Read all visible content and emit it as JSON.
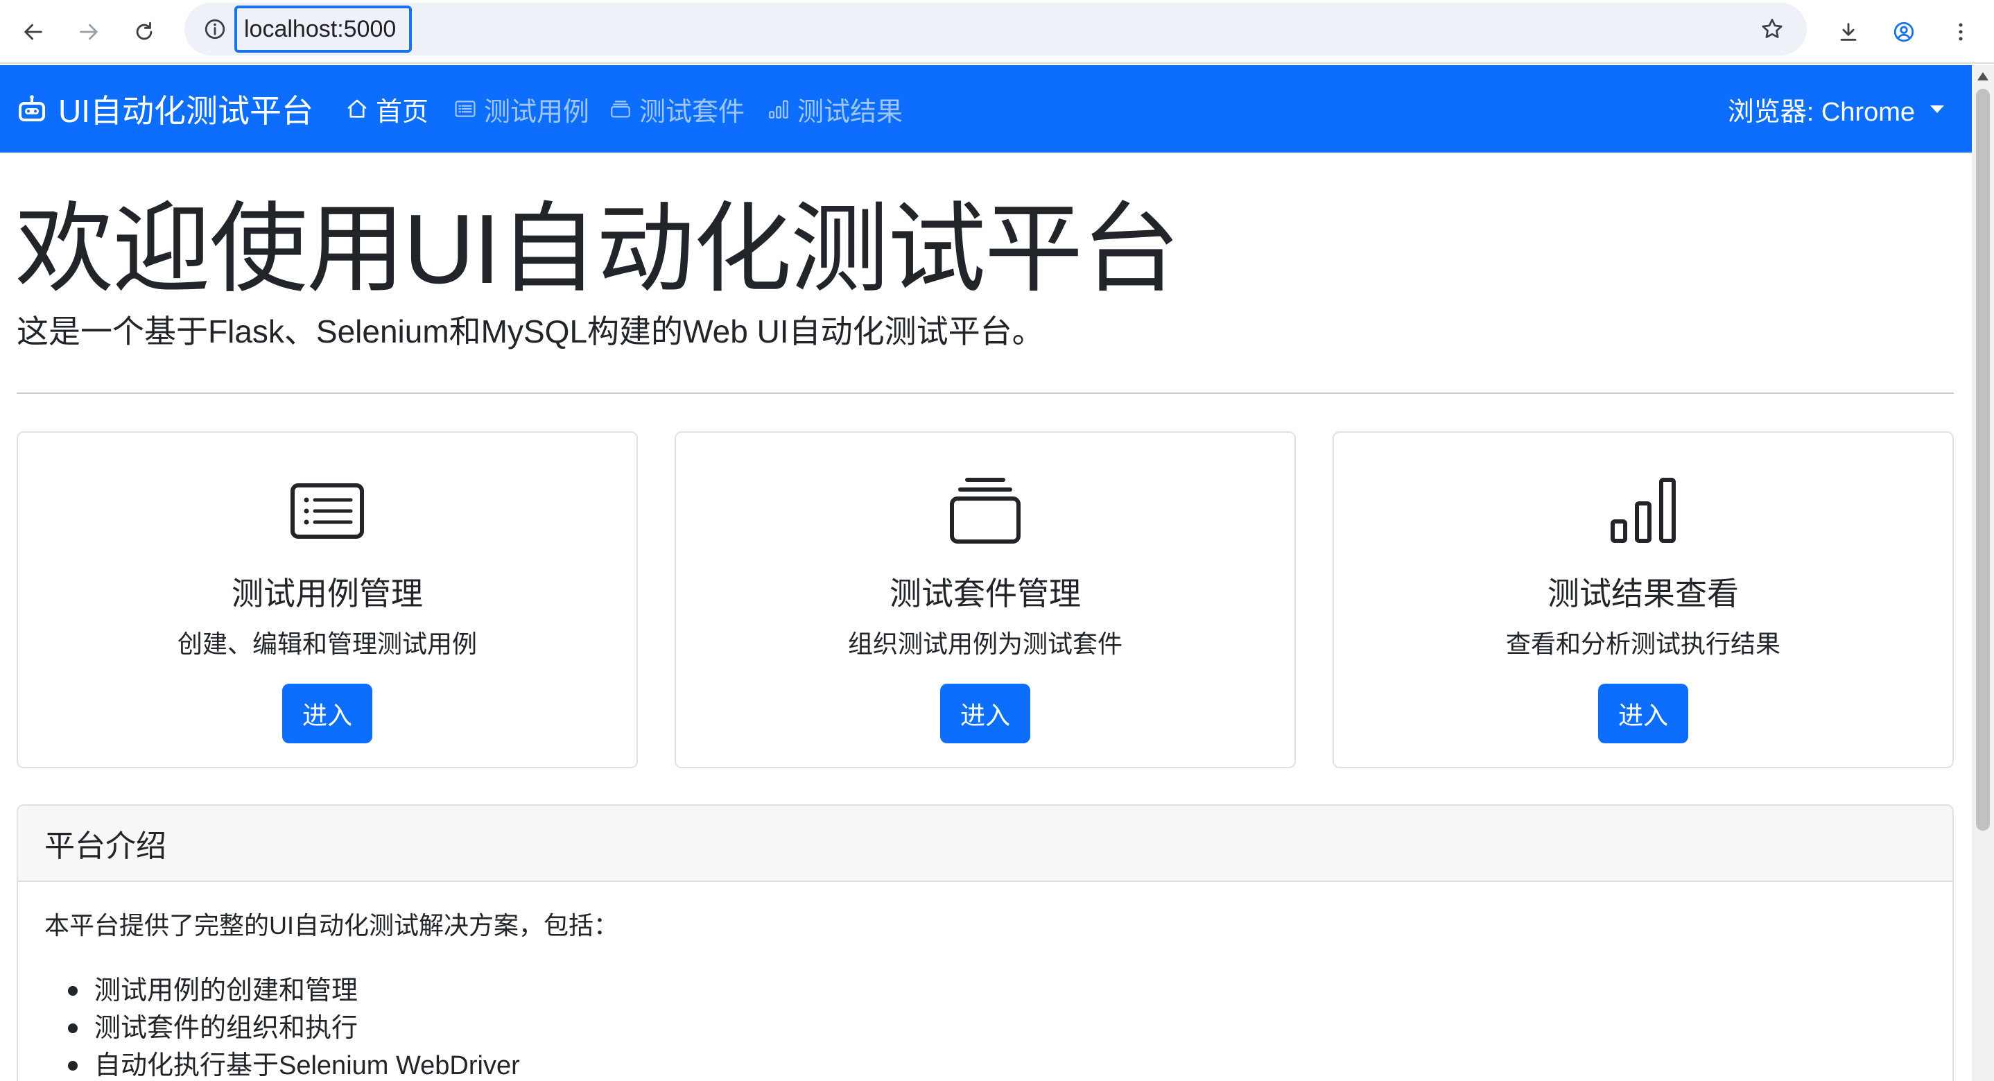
{
  "browser": {
    "url": "localhost:5000"
  },
  "navbar": {
    "brand": "UI自动化测试平台",
    "items": [
      {
        "label": "首页",
        "icon": "house-icon",
        "active": true
      },
      {
        "label": "测试用例",
        "icon": "list-icon",
        "active": false
      },
      {
        "label": "测试套件",
        "icon": "collection-icon",
        "active": false
      },
      {
        "label": "测试结果",
        "icon": "bar-chart-icon",
        "active": false
      }
    ],
    "browser_select": "浏览器: Chrome"
  },
  "hero": {
    "title": "欢迎使用UI自动化测试平台",
    "lead": "这是一个基于Flask、Selenium和MySQL构建的Web UI自动化测试平台。"
  },
  "cards": [
    {
      "icon": "list-icon",
      "title": "测试用例管理",
      "text": "创建、编辑和管理测试用例",
      "button": "进入"
    },
    {
      "icon": "collection-icon",
      "title": "测试套件管理",
      "text": "组织测试用例为测试套件",
      "button": "进入"
    },
    {
      "icon": "bar-chart-icon",
      "title": "测试结果查看",
      "text": "查看和分析测试执行结果",
      "button": "进入"
    }
  ],
  "intro": {
    "header": "平台介绍",
    "text": "本平台提供了完整的UI自动化测试解决方案，包括：",
    "items": [
      "测试用例的创建和管理",
      "测试套件的组织和执行",
      "自动化执行基于Selenium WebDriver"
    ]
  },
  "colors": {
    "primary": "#0d6efd",
    "card_border": "#dfe2e5",
    "panel_header_bg": "#f7f7f7"
  }
}
